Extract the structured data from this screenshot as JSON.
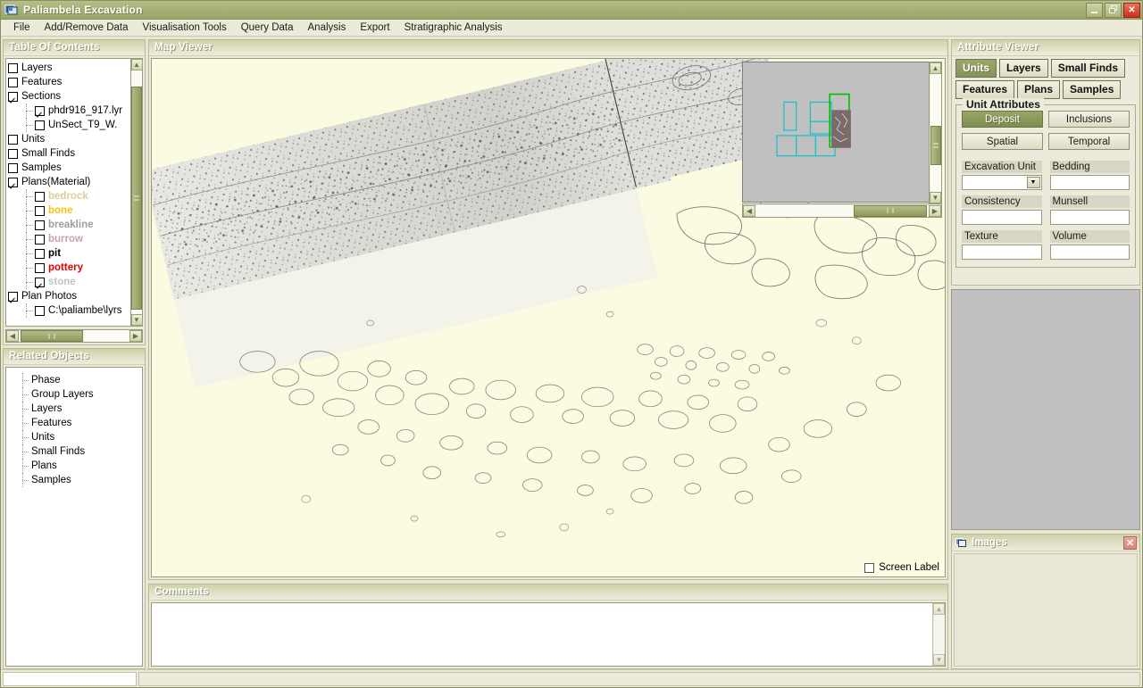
{
  "window": {
    "title": "Paliambela Excavation",
    "icon": "application-icon",
    "minimize_label": "_",
    "restore_label": "❐",
    "close_label": "✕"
  },
  "menu": {
    "items": [
      "File",
      "Add/Remove Data",
      "Visualisation Tools",
      "Query Data",
      "Analysis",
      "Export",
      "Stratigraphic Analysis"
    ]
  },
  "table_of_contents": {
    "caption": "Table Of Contents",
    "items": [
      {
        "label": "Layers",
        "checked": false,
        "indent": 0,
        "color": "#000000",
        "bold": false
      },
      {
        "label": "Features",
        "checked": false,
        "indent": 0,
        "color": "#000000",
        "bold": false
      },
      {
        "label": "Sections",
        "checked": true,
        "indent": 0,
        "color": "#000000",
        "bold": false
      },
      {
        "label": "phdr916_917.lyr",
        "checked": true,
        "indent": 1,
        "color": "#000000",
        "bold": false
      },
      {
        "label": "UnSect_T9_W.",
        "checked": false,
        "indent": 1,
        "color": "#000000",
        "bold": false
      },
      {
        "label": "Units",
        "checked": false,
        "indent": 0,
        "color": "#000000",
        "bold": false
      },
      {
        "label": "Small Finds",
        "checked": false,
        "indent": 0,
        "color": "#000000",
        "bold": false
      },
      {
        "label": "Samples",
        "checked": false,
        "indent": 0,
        "color": "#000000",
        "bold": false
      },
      {
        "label": "Plans(Material)",
        "checked": true,
        "indent": 0,
        "color": "#000000",
        "bold": false
      },
      {
        "label": "bedrock",
        "checked": false,
        "indent": 1,
        "color": "#d8cf9a",
        "bold": true
      },
      {
        "label": "bone",
        "checked": false,
        "indent": 1,
        "color": "#f5c518",
        "bold": true
      },
      {
        "label": "breakline",
        "checked": false,
        "indent": 1,
        "color": "#9d9d9d",
        "bold": true
      },
      {
        "label": "burrow",
        "checked": false,
        "indent": 1,
        "color": "#c9a0a8",
        "bold": true
      },
      {
        "label": "pit",
        "checked": false,
        "indent": 1,
        "color": "#000000",
        "bold": true
      },
      {
        "label": "pottery",
        "checked": false,
        "indent": 1,
        "color": "#e00000",
        "bold": true
      },
      {
        "label": "stone",
        "checked": true,
        "indent": 1,
        "color": "#c3c3c3",
        "bold": true
      },
      {
        "label": "Plan Photos",
        "checked": true,
        "indent": 0,
        "color": "#000000",
        "bold": false
      },
      {
        "label": "C:\\paliambe\\lyrs",
        "checked": false,
        "indent": 1,
        "color": "#000000",
        "bold": false
      }
    ],
    "scroll": {
      "up_arrow": "▲",
      "down_arrow": "▼",
      "left_arrow": "◀",
      "right_arrow": "▶"
    }
  },
  "related_objects": {
    "caption": "Related Objects",
    "items": [
      "Phase",
      "Group Layers",
      "Layers",
      "Features",
      "Units",
      "Small Finds",
      "Plans",
      "Samples"
    ]
  },
  "map_viewer": {
    "caption": "Map Viewer",
    "background_color": "#fbfbe2",
    "screen_label": {
      "label": "Screen Label",
      "checked": false
    },
    "overview": {
      "background_color": "#c0c0c0",
      "extent_outline_color": "#00c000",
      "grid_outline_color": "#1fc0c8",
      "scroll": {
        "left_arrow": "◀",
        "right_arrow": "▶",
        "up_arrow": "▲",
        "down_arrow": "▼"
      }
    }
  },
  "comments": {
    "caption": "Comments",
    "value": "",
    "scroll": {
      "up_arrow": "▲",
      "down_arrow": "▼"
    }
  },
  "attribute_viewer": {
    "caption": "Attribute Viewer",
    "tabs_row1": [
      {
        "label": "Units",
        "active": true
      },
      {
        "label": "Layers",
        "active": false
      },
      {
        "label": "Small Finds",
        "active": false
      }
    ],
    "tabs_row2": [
      {
        "label": "Features",
        "active": false
      },
      {
        "label": "Plans",
        "active": false
      },
      {
        "label": "Samples",
        "active": false
      }
    ],
    "group_title": "Unit Attributes",
    "buttons": [
      {
        "label": "Deposit",
        "active": true
      },
      {
        "label": "Inclusions",
        "active": false
      },
      {
        "label": "Spatial",
        "active": false
      },
      {
        "label": "Temporal",
        "active": false
      }
    ],
    "fields": [
      {
        "label": "Excavation Unit",
        "value": "",
        "type": "combo"
      },
      {
        "label": "Bedding",
        "value": "",
        "type": "text"
      },
      {
        "label": "Consistency",
        "value": "",
        "type": "text"
      },
      {
        "label": "Munsell",
        "value": "",
        "type": "text"
      },
      {
        "label": "Texture",
        "value": "",
        "type": "text"
      },
      {
        "label": "Volume",
        "value": "",
        "type": "text"
      }
    ],
    "combo_arrow": "▼"
  },
  "images_panel": {
    "caption": "Images",
    "icon": "images-icon",
    "close_label": "✕"
  },
  "status_bar": {
    "cell_1": "",
    "cell_2": ""
  }
}
